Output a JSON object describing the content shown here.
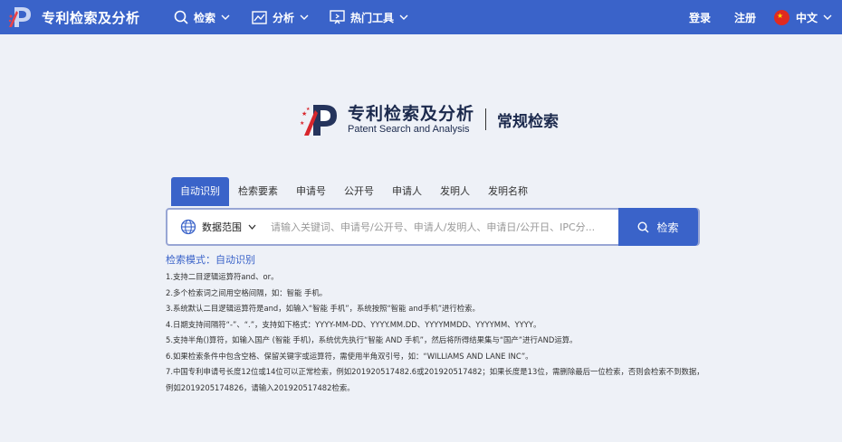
{
  "header": {
    "brand_name": "专利检索及分析",
    "nav": [
      {
        "label": "检索",
        "icon": "search-icon"
      },
      {
        "label": "分析",
        "icon": "chart-icon"
      },
      {
        "label": "热门工具",
        "icon": "monitor-icon"
      }
    ],
    "login": "登录",
    "register": "注册",
    "language": "中文"
  },
  "hero": {
    "title_cn": "专利检索及分析",
    "title_en": "Patent Search and Analysis",
    "mode_title": "常规检索"
  },
  "tabs": [
    {
      "label": "自动识别",
      "active": true
    },
    {
      "label": "检索要素",
      "active": false
    },
    {
      "label": "申请号",
      "active": false
    },
    {
      "label": "公开号",
      "active": false
    },
    {
      "label": "申请人",
      "active": false
    },
    {
      "label": "发明人",
      "active": false
    },
    {
      "label": "发明名称",
      "active": false
    }
  ],
  "search": {
    "scope_label": "数据范围",
    "placeholder": "请输入关键词、申请号/公开号、申请人/发明人、申请日/公开日、IPC分...",
    "button_label": "检索"
  },
  "mode_line": "检索模式：自动识别",
  "tips": [
    "1.支持二目逻辑运算符and、or。",
    "2.多个检索词之间用空格间隔，如：智能 手机。",
    "3.系统默认二目逻辑运算符是and，如输入“智能 手机”，系统按照“智能 and手机”进行检索。",
    "4.日期支持间隔符“-”、“.”，支持如下格式：YYYY-MM-DD、YYYY.MM.DD、YYYYMMDD、YYYYMM、YYYY。",
    "5.支持半角()算符，如输入国产 (智能 手机)，系统优先执行“智能 AND 手机”，然后将所得结果集与“国产”进行AND运算。",
    "6.如果检索条件中包含空格、保留关键字或运算符，需使用半角双引号，如：“WILLIAMS AND LANE INC”。",
    "7.中国专利申请号长度12位或14位可以正常检索，例如201920517482.6或201920517482；如果长度是13位，需删除最后一位检索，否则会检索不到数据，例如2019205174826，请输入201920517482检索。"
  ],
  "colors": {
    "primary": "#3a63c9",
    "page_background": "#eef1f7",
    "logo_red": "#d8262c"
  }
}
